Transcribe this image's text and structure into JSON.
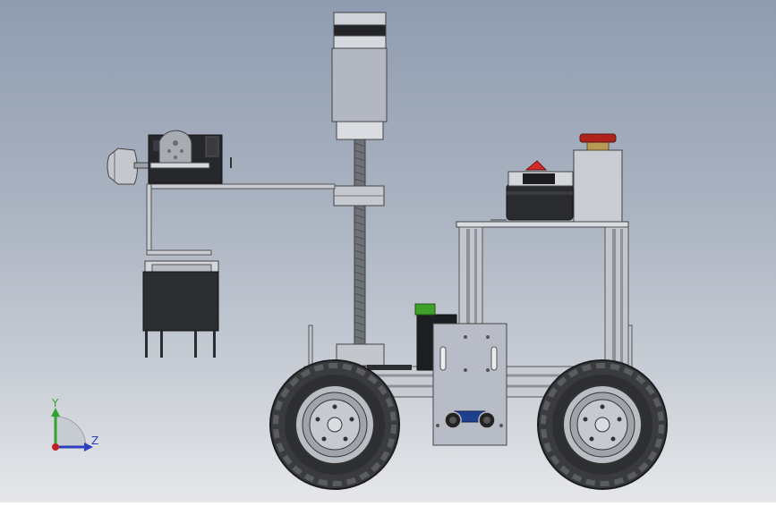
{
  "viewport": {
    "background_top": "#8f9cb0",
    "background_bottom": "#e6e7ea"
  },
  "model": {
    "subject": "robot-cart-with-lift-and-arm",
    "colors": {
      "aluminum": "#c9ccd2",
      "aluminum_dark": "#8e939b",
      "black_part": "#2a2b2e",
      "tire": "#3a3b3e",
      "plate": "#b8bcc6",
      "lead_screw": "#6f7378",
      "green_module": "#3fa02a",
      "red_switch": "#d42a26",
      "estop_red": "#b0231d",
      "brass": "#b79a56",
      "sensor_blue": "#1f3f8f"
    }
  },
  "triad": {
    "y_label": "Y",
    "z_label": "Z",
    "y_color": "#2fa52f",
    "z_color": "#2b3fbf",
    "x_color": "#c02020"
  }
}
